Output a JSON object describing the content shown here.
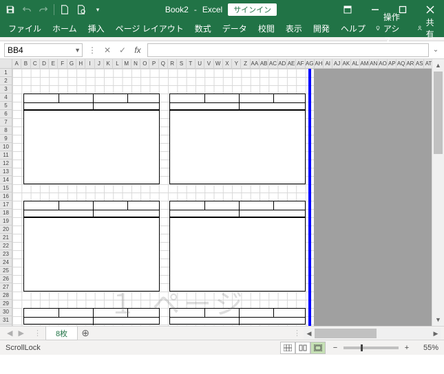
{
  "title": {
    "doc": "Book2",
    "app": "Excel",
    "signin": "サインイン"
  },
  "ribbon": {
    "tabs": [
      "ファイル",
      "ホーム",
      "挿入",
      "ページ レイアウト",
      "数式",
      "データ",
      "校閲",
      "表示",
      "開発",
      "ヘルプ"
    ],
    "tell_me": "操作アシス",
    "share": "共有"
  },
  "formula": {
    "name_box": "BB4",
    "value": ""
  },
  "columns": [
    "A",
    "B",
    "C",
    "D",
    "E",
    "F",
    "G",
    "H",
    "I",
    "J",
    "K",
    "L",
    "M",
    "N",
    "O",
    "P",
    "Q",
    "R",
    "S",
    "T",
    "U",
    "V",
    "W",
    "X",
    "Y",
    "Z",
    "AA",
    "AB",
    "AC",
    "AD",
    "AE",
    "AF",
    "AG",
    "AH",
    "AI",
    "AJ",
    "AK",
    "AL",
    "AM",
    "AN",
    "AO",
    "AP",
    "AQ",
    "AR",
    "AS",
    "AT"
  ],
  "rows": [
    "1",
    "2",
    "3",
    "4",
    "5",
    "6",
    "7",
    "8",
    "9",
    "10",
    "11",
    "12",
    "13",
    "14",
    "15",
    "16",
    "17",
    "18",
    "19",
    "20",
    "21",
    "22",
    "23",
    "24",
    "25",
    "26",
    "27",
    "28",
    "29",
    "30",
    "31"
  ],
  "watermark": "１ ページ",
  "sheet_tabs": {
    "active": "8枚"
  },
  "status": {
    "mode": "ScrollLock",
    "zoom": "55%"
  }
}
